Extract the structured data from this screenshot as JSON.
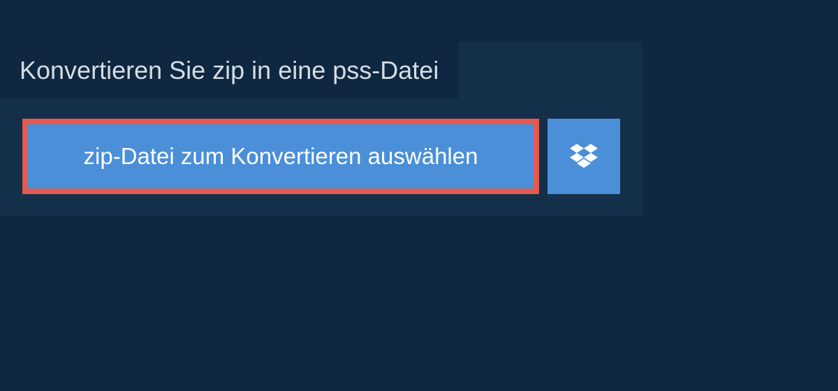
{
  "title": "Konvertieren Sie zip in eine pss-Datei",
  "select_button_label": "zip-Datei zum Konvertieren auswählen",
  "colors": {
    "background": "#0f2740",
    "panel": "#142f49",
    "button": "#4a8fd8",
    "highlight_border": "#e55a4f",
    "text_light": "#d5dde5",
    "text_white": "#ffffff"
  }
}
